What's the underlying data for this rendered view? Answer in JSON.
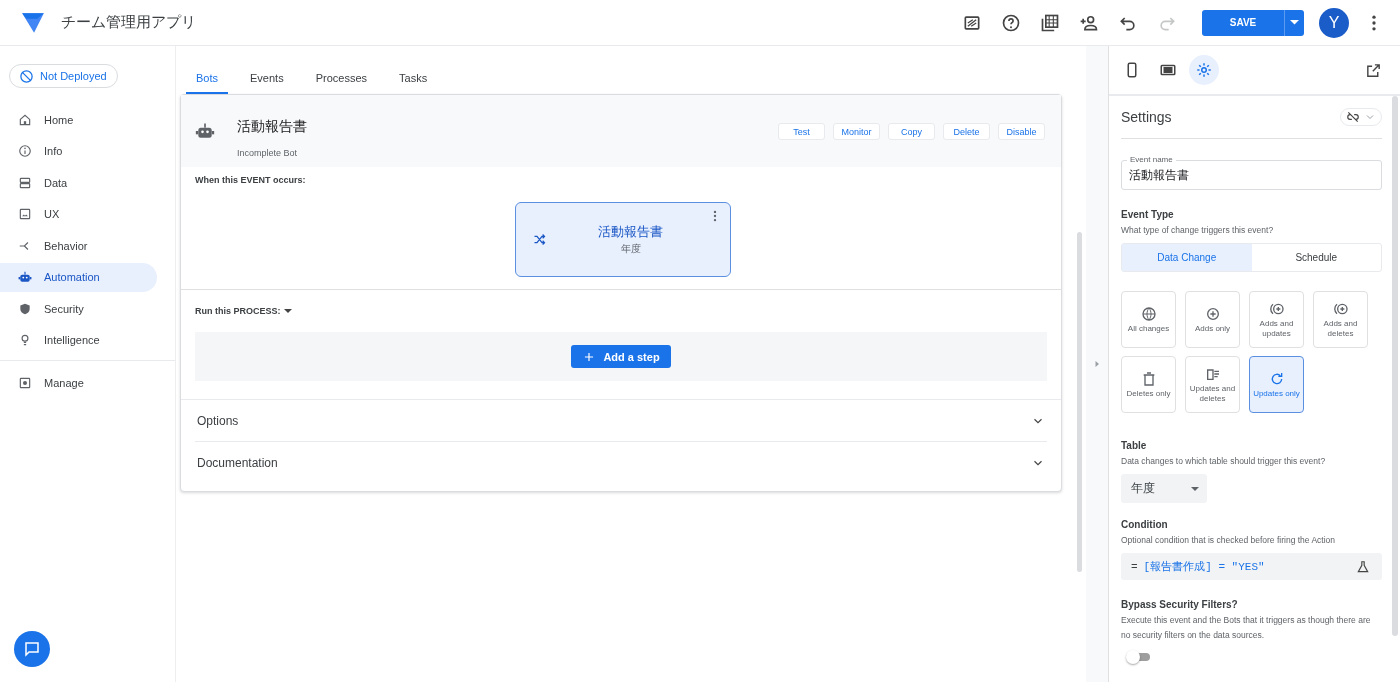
{
  "app": {
    "title": "チーム管理用アプリ"
  },
  "topbar": {
    "save": "SAVE",
    "avatar": "Y"
  },
  "deploy_status": "Not Deployed",
  "sidebar": {
    "items": [
      {
        "label": "Home",
        "selected": false
      },
      {
        "label": "Info",
        "selected": false
      },
      {
        "label": "Data",
        "selected": false
      },
      {
        "label": "UX",
        "selected": false
      },
      {
        "label": "Behavior",
        "selected": false
      },
      {
        "label": "Automation",
        "selected": true
      },
      {
        "label": "Security",
        "selected": false
      },
      {
        "label": "Intelligence",
        "selected": false
      },
      {
        "label": "Manage",
        "selected": false
      }
    ]
  },
  "tabs": [
    {
      "label": "Bots",
      "selected": true
    },
    {
      "label": "Events",
      "selected": false
    },
    {
      "label": "Processes",
      "selected": false
    },
    {
      "label": "Tasks",
      "selected": false
    }
  ],
  "bot": {
    "name": "活動報告書",
    "status": "Incomplete Bot",
    "actions": [
      "Test",
      "Monitor",
      "Copy",
      "Delete",
      "Disable"
    ]
  },
  "event_section": {
    "label": "When this EVENT occurs:",
    "card": {
      "title": "活動報告書",
      "subtitle": "年度"
    }
  },
  "process_section": {
    "label": "Run this PROCESS:",
    "button": "Add a step"
  },
  "accordions": [
    {
      "label": "Options",
      "expanded": false
    },
    {
      "label": "Documentation",
      "expanded": false
    }
  ],
  "panel": {
    "view_tabs": [
      {
        "selected": false
      },
      {
        "selected": false
      },
      {
        "selected": true
      }
    ],
    "title": "Settings",
    "event_name": {
      "label": "Event name",
      "value": "活動報告書"
    },
    "event_type": {
      "title": "Event Type",
      "hint": "What type of change triggers this event?",
      "segments": [
        {
          "label": "Data Change",
          "selected": true
        },
        {
          "label": "Schedule",
          "selected": false
        }
      ],
      "options": [
        {
          "label": "All changes",
          "selected": false
        },
        {
          "label": "Adds only",
          "selected": false
        },
        {
          "label": "Adds and updates",
          "selected": false
        },
        {
          "label": "Adds and deletes",
          "selected": false
        },
        {
          "label": "Deletes only",
          "selected": false
        },
        {
          "label": "Updates and deletes",
          "selected": false
        },
        {
          "label": "Updates only",
          "selected": true
        }
      ]
    },
    "table": {
      "title": "Table",
      "hint": "Data changes to which table should trigger this event?",
      "value": "年度"
    },
    "condition": {
      "title": "Condition",
      "hint": "Optional condition that is checked before firing the Action",
      "operator": "=",
      "expression": "[報告書作成] = \"YES\""
    },
    "bypass": {
      "title": "Bypass Security Filters?",
      "hint": "Execute this event and the Bots that it triggers as though there are no security filters on the data sources.",
      "on": false
    }
  }
}
